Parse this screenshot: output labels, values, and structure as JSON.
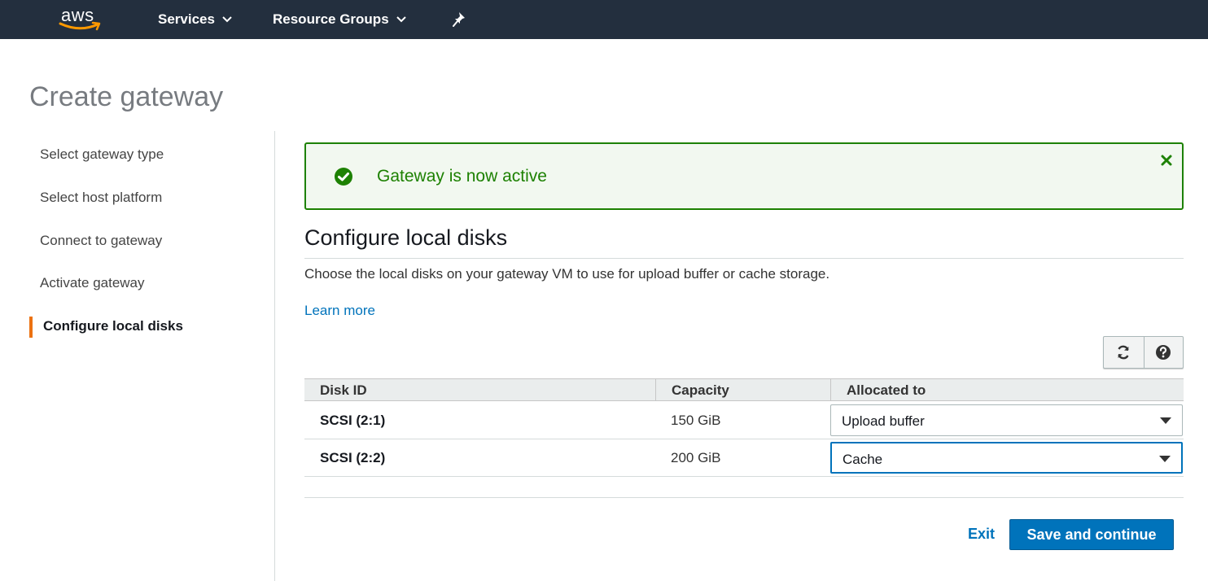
{
  "topbar": {
    "logo_text": "aws",
    "services_label": "Services",
    "resource_groups_label": "Resource Groups",
    "pin_icon": "pushpin-icon"
  },
  "page": {
    "title": "Create gateway"
  },
  "wizard": {
    "steps": [
      {
        "label": "Select gateway type",
        "active": false
      },
      {
        "label": "Select host platform",
        "active": false
      },
      {
        "label": "Connect to gateway",
        "active": false
      },
      {
        "label": "Activate gateway",
        "active": false
      },
      {
        "label": "Configure local disks",
        "active": true
      }
    ],
    "active_color": "#ec7211"
  },
  "alert": {
    "message": "Gateway is now active",
    "type": "success",
    "color": "#1d8102",
    "icon": "check-circle-icon",
    "close_icon": "close-icon"
  },
  "section": {
    "title": "Configure local disks",
    "description": "Choose the local disks on your gateway VM to use for upload buffer or cache storage.",
    "learn_more": "Learn more"
  },
  "toolbar": {
    "refresh_icon": "refresh-icon",
    "help_icon": "help-icon"
  },
  "table": {
    "headers": {
      "disk_id": "Disk ID",
      "capacity": "Capacity",
      "allocated_to": "Allocated to"
    },
    "rows": [
      {
        "disk_id": "SCSI (2:1)",
        "capacity": "150 GiB",
        "allocated_to": "Upload buffer"
      },
      {
        "disk_id": "SCSI (2:2)",
        "capacity": "200 GiB",
        "allocated_to": "Cache"
      }
    ]
  },
  "actions": {
    "exit_label": "Exit",
    "primary_label": "Save and continue",
    "primary_color": "#0073bb"
  }
}
